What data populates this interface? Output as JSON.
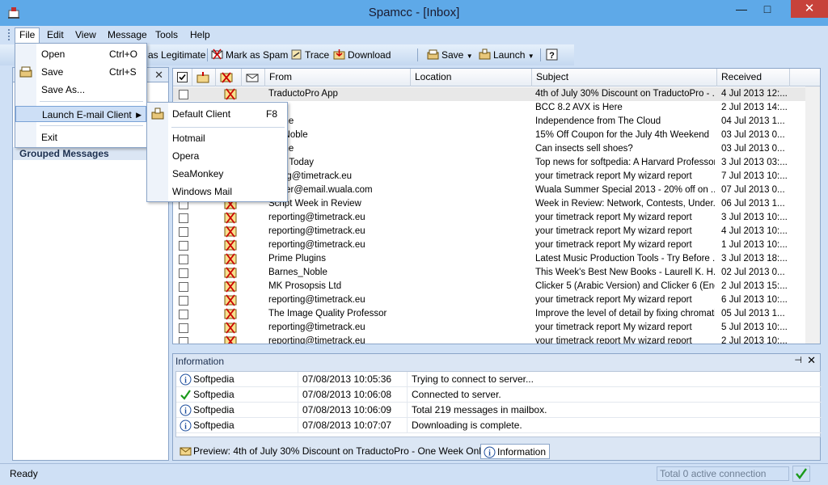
{
  "window": {
    "title": "Spamcc - [Inbox]"
  },
  "menubar": {
    "items": [
      "File",
      "Edit",
      "View",
      "Message",
      "Tools",
      "Help"
    ]
  },
  "toolbar": {
    "legitimate_label": "as Legitimate",
    "spam_label": "Mark as Spam",
    "trace_label": "Trace",
    "download_label": "Download",
    "save_label": "Save",
    "launch_label": "Launch"
  },
  "left_panel": {
    "grouped_label": "Grouped Messages"
  },
  "file_menu": {
    "items": [
      {
        "label": "Open",
        "shortcut": "Ctrl+O"
      },
      {
        "label": "Save",
        "shortcut": "Ctrl+S"
      },
      {
        "label": "Save As...",
        "shortcut": ""
      },
      {
        "label": "Launch E-mail Client",
        "shortcut": ""
      },
      {
        "label": "Exit",
        "shortcut": ""
      }
    ]
  },
  "launch_submenu": {
    "items": [
      {
        "label": "Default Client",
        "shortcut": "F8"
      },
      {
        "label": "Hotmail",
        "shortcut": ""
      },
      {
        "label": "Opera",
        "shortcut": ""
      },
      {
        "label": "SeaMonkey",
        "shortcut": ""
      },
      {
        "label": "Windows Mail",
        "shortcut": ""
      }
    ]
  },
  "message_list": {
    "columns": [
      "From",
      "Location",
      "Subject",
      "Received"
    ],
    "rows": [
      {
        "from": "TraductoPro App",
        "subject": "4th of July 30% Discount on TraductoPro - ...",
        "received": "4 Jul 2013 12:..."
      },
      {
        "from": "FX",
        "subject": "BCC 8.2 AVX is Here",
        "received": "2 Jul 2013 14:..."
      },
      {
        "from": "e One",
        "subject": "Independence from The Cloud",
        "received": "04 Jul 2013 1..."
      },
      {
        "from": "es_Noble",
        "subject": "15% Off Coupon for the July 4th Weekend",
        "received": "03 Jul 2013 0..."
      },
      {
        "from": "e One",
        "subject": "Can insects sell shoes?",
        "received": "03 Jul 2013 0..."
      },
      {
        "from": "edIn Today",
        "subject": "Top news for softpedia: A Harvard Professor...",
        "received": "3 Jul 2013 03:..."
      },
      {
        "from": "orting@timetrack.eu",
        "subject": "your timetrack report My wizard report",
        "received": "7 Jul 2013 10:..."
      },
      {
        "from": "sletter@email.wuala.com",
        "subject": "Wuala Summer Special 2013 - 20% off on ...",
        "received": "07 Jul 2013 0..."
      },
      {
        "from": "Script Week in Review",
        "subject": "Week in Review: Network, Contests, Under...",
        "received": "06 Jul 2013 1..."
      },
      {
        "from": "reporting@timetrack.eu",
        "subject": "your timetrack report My wizard report",
        "received": "3 Jul 2013 10:..."
      },
      {
        "from": "reporting@timetrack.eu",
        "subject": "your timetrack report My wizard report",
        "received": "4 Jul 2013 10:..."
      },
      {
        "from": "reporting@timetrack.eu",
        "subject": "your timetrack report My wizard report",
        "received": "1 Jul 2013 10:..."
      },
      {
        "from": "Prime Plugins",
        "subject": "Latest Music Production Tools - Try Before ...",
        "received": "3 Jul 2013 18:..."
      },
      {
        "from": "Barnes_Noble",
        "subject": "This Week's Best New Books - Laurell K. H...",
        "received": "02 Jul 2013 0..."
      },
      {
        "from": "MK Prosopsis Ltd",
        "subject": "Clicker 5 (Arabic Version) and Clicker 6 (Eng...",
        "received": "2 Jul 2013 15:..."
      },
      {
        "from": "reporting@timetrack.eu",
        "subject": "your timetrack report My wizard report",
        "received": "6 Jul 2013 10:..."
      },
      {
        "from": "The Image Quality Professor",
        "subject": "Improve the level of detail by fixing chromati...",
        "received": "05 Jul 2013 1..."
      },
      {
        "from": "reporting@timetrack.eu",
        "subject": "your timetrack report My wizard report",
        "received": "5 Jul 2013 10:..."
      },
      {
        "from": "reporting@timetrack.eu",
        "subject": "your timetrack report My wizard report",
        "received": "2 Jul 2013 10:..."
      }
    ]
  },
  "info_panel": {
    "title": "Information",
    "log": [
      {
        "source": "Softpedia",
        "time": "07/08/2013 10:05:36",
        "message": "Trying to connect to server...",
        "icon": "info-icon"
      },
      {
        "source": "Softpedia",
        "time": "07/08/2013 10:06:08",
        "message": "Connected to server.",
        "icon": "checkmark-icon"
      },
      {
        "source": "Softpedia",
        "time": "07/08/2013 10:06:09",
        "message": "Total 219 messages in mailbox.",
        "icon": "info-icon"
      },
      {
        "source": "Softpedia",
        "time": "07/08/2013 10:07:07",
        "message": "Downloading is complete.",
        "icon": "info-icon"
      }
    ],
    "tabs": [
      {
        "label": "Preview: 4th of July 30% Discount on TraductoPro - One Week Only!"
      },
      {
        "label": "Information"
      }
    ]
  },
  "statusbar": {
    "ready": "Ready",
    "connections": "Total 0 active connection"
  },
  "colors": {
    "title_bar": "#5ea9e8",
    "chrome": "#cfe0f5",
    "close_button": "#c7423a",
    "menu_highlight": "#cddff6"
  }
}
